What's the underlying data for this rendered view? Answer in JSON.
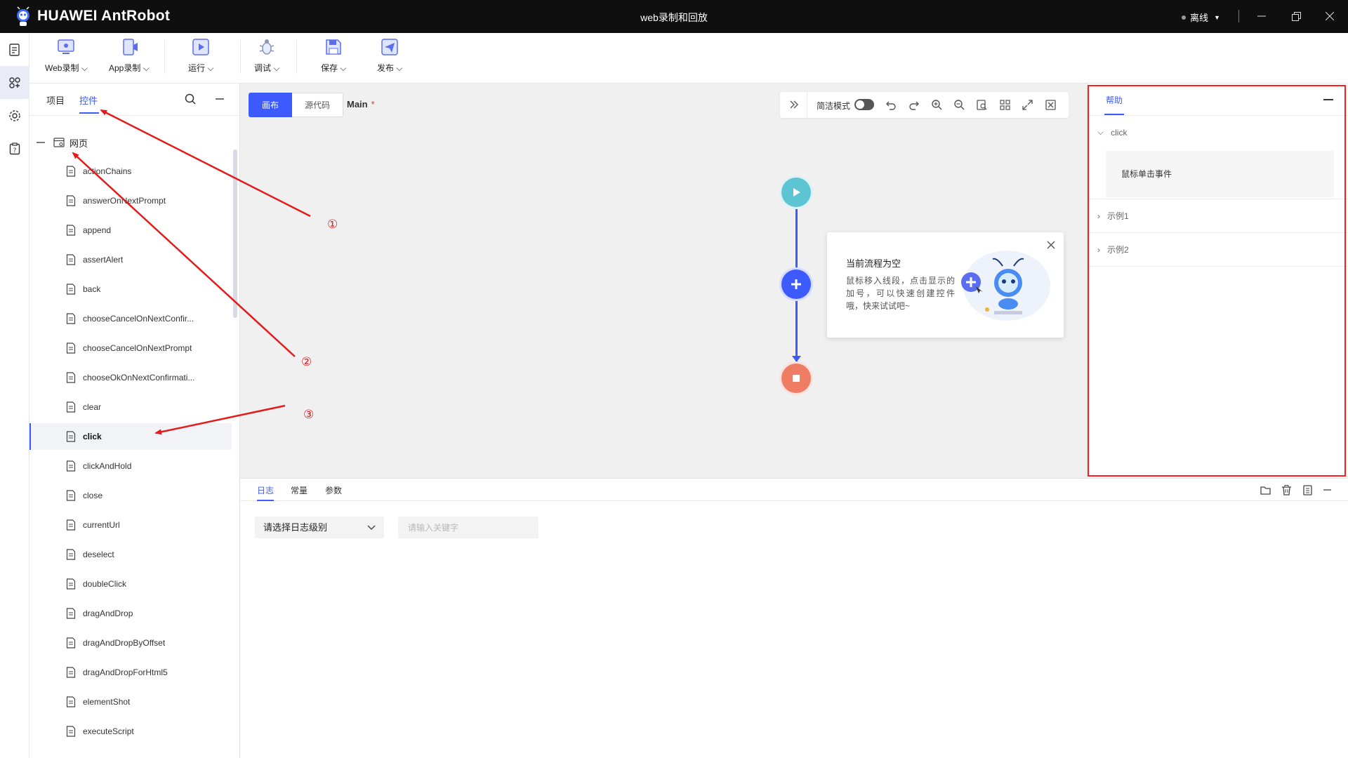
{
  "titlebar": {
    "app_name": "HUAWEI AntRobot",
    "window_title": "web录制和回放",
    "status_label": "离线"
  },
  "rail": {
    "items": [
      "document-icon",
      "components-icon",
      "settings-gear-icon",
      "help-clipboard-icon"
    ],
    "active_index": 1
  },
  "toolbar": {
    "web_record": "Web录制",
    "app_record": "App录制",
    "run": "运行",
    "debug": "调试",
    "save": "保存",
    "publish": "发布"
  },
  "left_panel": {
    "tab_project": "项目",
    "tab_controls": "控件",
    "tree_root": "网页",
    "items": [
      "actionChains",
      "answerOnNextPrompt",
      "append",
      "assertAlert",
      "back",
      "chooseCancelOnNextConfir...",
      "chooseCancelOnNextPrompt",
      "chooseOkOnNextConfirmati...",
      "clear",
      "click",
      "clickAndHold",
      "close",
      "currentUrl",
      "deselect",
      "doubleClick",
      "dragAndDrop",
      "dragAndDropByOffset",
      "dragAndDropForHtml5",
      "elementShot",
      "executeScript"
    ],
    "active_item": "click"
  },
  "canvas": {
    "tab_canvas": "画布",
    "tab_source": "源代码",
    "file_name": "Main",
    "modified_mark": "*",
    "compact_mode_label": "简洁模式",
    "compact_mode_on": false,
    "tip_title": "当前流程为空",
    "tip_body": "鼠标移入线段，点击显示的加号，可以快速创建控件哦，快来试试吧~"
  },
  "log_panel": {
    "tab_log": "日志",
    "tab_constants": "常量",
    "tab_params": "参数",
    "level_select_value": "请选择日志级别",
    "keyword_placeholder": "请输入关键字"
  },
  "help_panel": {
    "tab_help": "帮助",
    "section_title": "click",
    "section_desc": "鼠标单击事件",
    "example1": "示例1",
    "example2": "示例2"
  },
  "annotations": {
    "labels": [
      "①",
      "②",
      "③"
    ],
    "color": "#e41b1b"
  },
  "colors": {
    "accent": "#3d5afe",
    "flow_start": "#5cc4d3",
    "flow_end": "#ef7d63",
    "highlight_box": "#ff1d1d"
  }
}
